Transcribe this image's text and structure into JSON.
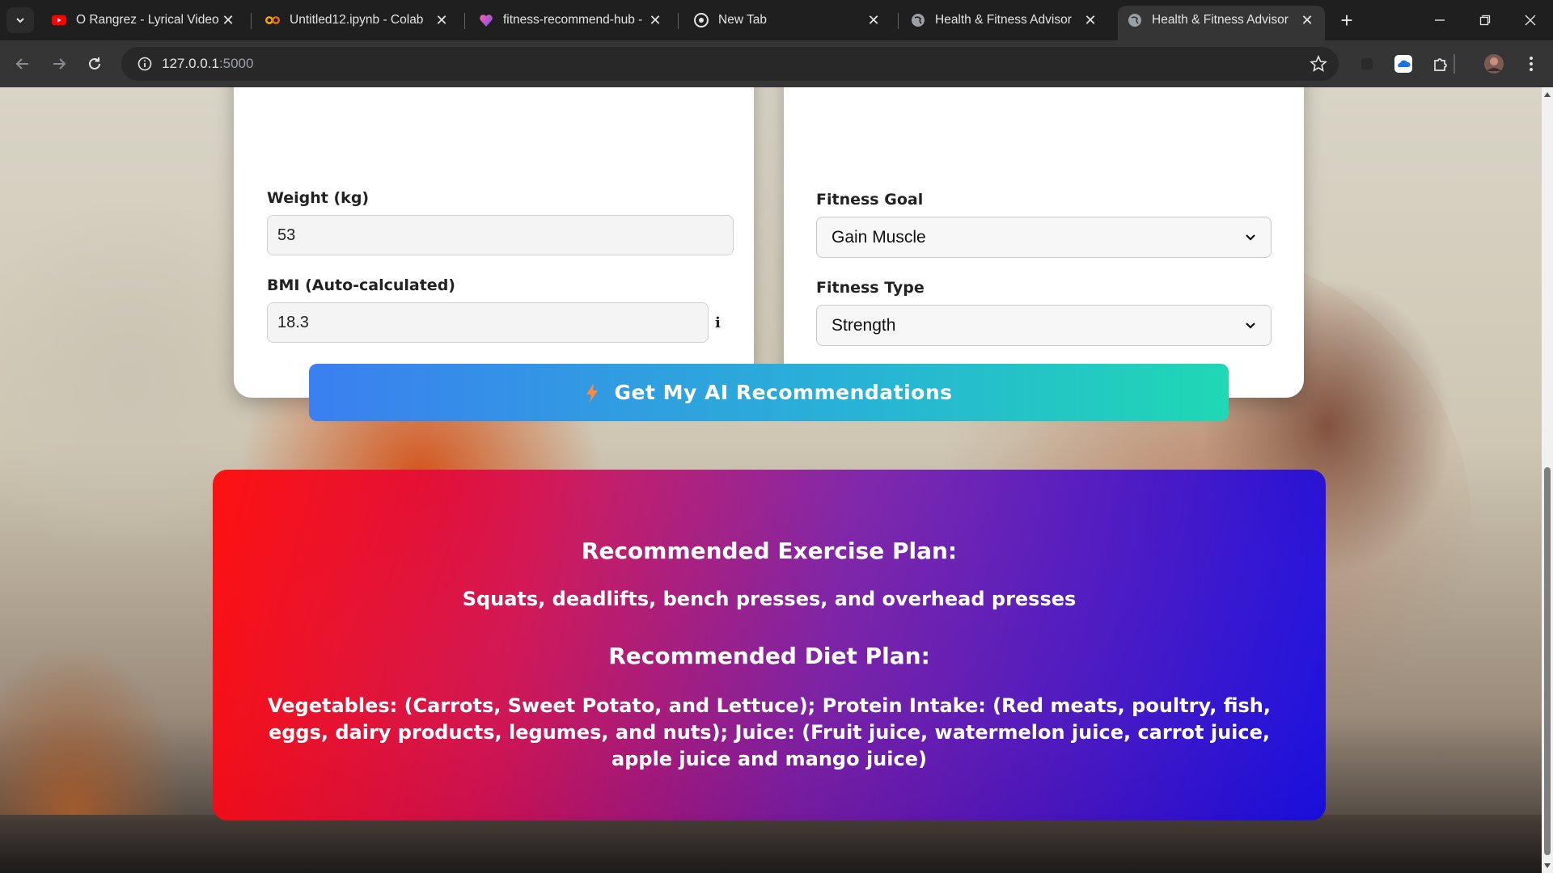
{
  "browser": {
    "tabs": [
      {
        "title": "O Rangrez - Lyrical Video |",
        "icon": "youtube-icon"
      },
      {
        "title": "Untitled12.ipynb - Colab",
        "icon": "colab-icon"
      },
      {
        "title": "fitness-recommend-hub -",
        "icon": "lovable-icon"
      },
      {
        "title": "New Tab",
        "icon": "chrome-icon"
      },
      {
        "title": "Health & Fitness Advisor",
        "icon": "globe-icon"
      },
      {
        "title": "Health & Fitness Advisor",
        "icon": "globe-icon",
        "active": true
      }
    ],
    "url_host": "127.0.0.1",
    "url_port": ":5000"
  },
  "form": {
    "weight_label": "Weight (kg)",
    "weight_value": "53",
    "bmi_label": "BMI (Auto-calculated)",
    "bmi_value": "18.3",
    "bmi_info": "i",
    "goal_label": "Fitness Goal",
    "goal_value": "Gain Muscle",
    "type_label": "Fitness Type",
    "type_value": "Strength"
  },
  "cta": {
    "label": "Get My AI Recommendations"
  },
  "results": {
    "exercise_heading": "Recommended Exercise Plan:",
    "exercise_text": "Squats, deadlifts, bench presses, and overhead presses",
    "diet_heading": "Recommended Diet Plan:",
    "diet_text": "Vegetables: (Carrots, Sweet Potato, and Lettuce); Protein Intake: (Red meats, poultry, fish, eggs, dairy products, legumes, and nuts); Juice: (Fruit juice, watermelon juice, carrot juice, apple juice and mango juice)"
  },
  "colors": {
    "cta_start": "#3b7ff0",
    "cta_end": "#1fd8b4",
    "result_start": "#ff0a0a",
    "result_end": "#140ae6"
  }
}
